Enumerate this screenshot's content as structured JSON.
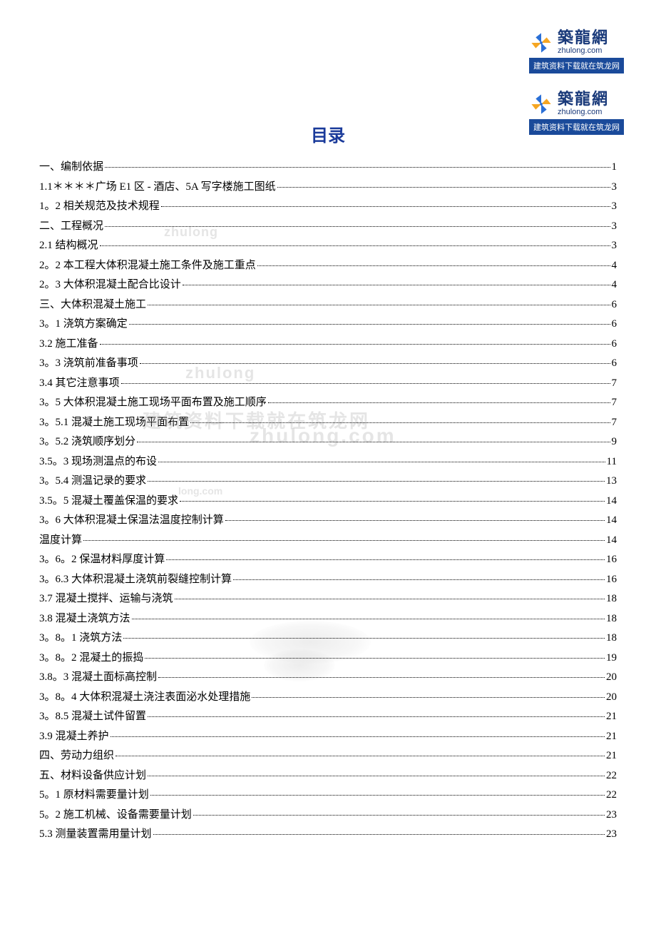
{
  "logo": {
    "cn": "築龍網",
    "en": "zhulong.com",
    "banner": "建筑资料下载就在筑龙网"
  },
  "heading": "目录",
  "watermarks": {
    "w1": "zhulong",
    "w2": "zhulong",
    "w3": "建筑资料下载就在筑龙网",
    "w4": "zhulong.com",
    "w5": "long.com"
  },
  "toc": [
    {
      "label": "一、编制依据",
      "page": "1"
    },
    {
      "label": "1.1＊＊＊＊广场 E1 区 - 酒店、5A 写字楼施工图纸",
      "page": "3"
    },
    {
      "label": "1。2 相关规范及技术规程",
      "page": "3"
    },
    {
      "label": "二、工程概况",
      "page": "3"
    },
    {
      "label": "2.1 结构概况",
      "page": "3"
    },
    {
      "label": "2。2 本工程大体积混凝土施工条件及施工重点",
      "page": "4"
    },
    {
      "label": "2。3 大体积混凝土配合比设计",
      "page": "4"
    },
    {
      "label": "三、大体积混凝土施工",
      "page": "6"
    },
    {
      "label": "3。1 浇筑方案确定",
      "page": "6"
    },
    {
      "label": "3.2 施工准备",
      "page": "6"
    },
    {
      "label": "3。3 浇筑前准备事项",
      "page": "6"
    },
    {
      "label": "3.4 其它注意事项",
      "page": "7"
    },
    {
      "label": "3。5 大体积混凝土施工现场平面布置及施工顺序",
      "page": "7"
    },
    {
      "label": "3。5.1 混凝土施工现场平面布置",
      "page": "7"
    },
    {
      "label": "3。5.2 浇筑顺序划分",
      "page": "9"
    },
    {
      "label": "3.5。3 现场测温点的布设",
      "page": "11"
    },
    {
      "label": "3。5.4 测温记录的要求",
      "page": "13"
    },
    {
      "label": "3.5。5 混凝土覆盖保温的要求",
      "page": "14"
    },
    {
      "label": "3。6 大体积混凝土保温法温度控制计算",
      "page": "14"
    },
    {
      "label": "温度计算",
      "page": "14"
    },
    {
      "label": "3。6。2 保温材料厚度计算",
      "page": "16"
    },
    {
      "label": "3。6.3 大体积混凝土浇筑前裂缝控制计算",
      "page": "16"
    },
    {
      "label": "3.7 混凝土搅拌、运输与浇筑",
      "page": "18"
    },
    {
      "label": "3.8 混凝土浇筑方法",
      "page": "18"
    },
    {
      "label": "3。8。1 浇筑方法",
      "page": "18"
    },
    {
      "label": "3。8。2 混凝土的振捣",
      "page": "19"
    },
    {
      "label": "3.8。3 混凝土面标高控制",
      "page": "20"
    },
    {
      "label": "3。8。4 大体积混凝土浇注表面泌水处理措施",
      "page": "20"
    },
    {
      "label": "3。8.5 混凝土试件留置",
      "page": "21"
    },
    {
      "label": "3.9 混凝土养护",
      "page": "21"
    },
    {
      "label": "四、劳动力组织",
      "page": "21"
    },
    {
      "label": "五、材料设备供应计划",
      "page": "22"
    },
    {
      "label": "5。1 原材料需要量计划",
      "page": "22"
    },
    {
      "label": "5。2 施工机械、设备需要量计划",
      "page": "23"
    },
    {
      "label": "5.3 测量装置需用量计划",
      "page": "23"
    }
  ]
}
